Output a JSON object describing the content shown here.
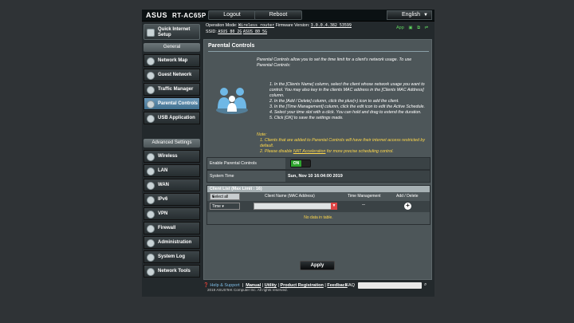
{
  "header": {
    "brand": "ASUS",
    "model": "RT-AC65P",
    "logout_label": "Logout",
    "reboot_label": "Reboot",
    "language": "English"
  },
  "info": {
    "op_mode_label": "Operation Mode:",
    "op_mode_value": "Wireless router",
    "fw_label": "Firmware Version:",
    "fw_value": "3.0.0.4.382_53599",
    "ssid_label": "SSID:",
    "ssid_24": "ASUS_80_2G",
    "ssid_5": "ASUS_80_5G",
    "app_label": "App"
  },
  "sidebar": {
    "quick_setup": "Quick Internet Setup",
    "general_header": "General",
    "general_items": [
      {
        "label": "Network Map",
        "icon": "network-map-icon"
      },
      {
        "label": "Guest Network",
        "icon": "guest-network-icon"
      },
      {
        "label": "Traffic Manager",
        "icon": "traffic-manager-icon"
      },
      {
        "label": "Parental Controls",
        "icon": "parental-controls-icon",
        "active": true
      },
      {
        "label": "USB Application",
        "icon": "usb-icon"
      }
    ],
    "advanced_header": "Advanced Settings",
    "advanced_items": [
      {
        "label": "Wireless",
        "icon": "wireless-icon"
      },
      {
        "label": "LAN",
        "icon": "lan-icon"
      },
      {
        "label": "WAN",
        "icon": "wan-icon"
      },
      {
        "label": "IPv6",
        "icon": "ipv6-icon"
      },
      {
        "label": "VPN",
        "icon": "vpn-icon"
      },
      {
        "label": "Firewall",
        "icon": "firewall-icon"
      },
      {
        "label": "Administration",
        "icon": "administration-icon"
      },
      {
        "label": "System Log",
        "icon": "system-log-icon"
      },
      {
        "label": "Network Tools",
        "icon": "network-tools-icon"
      }
    ]
  },
  "main": {
    "title": "Parental Controls",
    "description": "Parental Controls allow you to set the time limit for a client's network usage. To use Parental Controls:",
    "steps": [
      "1. In the [Clients Name] column, select the client whose network usage you want to control. You may also key in the clients MAC address in the [Clients MAC Address] column.",
      "2. In the [Add / Delete] column, click the plus(+) icon to add the client.",
      "3. In the [Time Management] column, click the edit icon to edit the Active Schedule.",
      "4. Select your time slot with a click. You can hold and drag to extend the duration.",
      "5. Click [OK] to save the settings made."
    ],
    "note_label": "Note:",
    "note1": "1. Clients that are added to Parental Controls will have their internet access restricted by default.",
    "note2_prefix": "2. Please disable ",
    "note2_link": "NAT Acceleration",
    "note2_suffix": " for more precise scheduling control.",
    "enable_label": "Enable Parental Controls",
    "enable_state": "ON",
    "system_time_label": "System Time",
    "system_time_value": "Sun, Nov 10 16:04:00 2019",
    "client_list_title": "Client List (Max Limit : 16)",
    "select_all": "Select all",
    "col_client_name": "Client Name (MAC Address)",
    "col_time_mgmt": "Time Management",
    "col_add_delete": "Add / Delete",
    "time_select": "Time",
    "time_mgmt_value": "--",
    "no_data": "No data in table.",
    "apply_label": "Apply"
  },
  "footer": {
    "help": "Help & Support",
    "manual": "Manual",
    "utility": "Utility",
    "product_registration": "Product Registration",
    "feedback": "Feedback",
    "faq": "FAQ",
    "copyright": "2019 ASUSTeK Computer Inc. All rights reserved."
  },
  "colors": {
    "accent_active": "#4f86aa",
    "toggle_on": "#2ea52e",
    "note_yellow": "#ffd84a"
  }
}
